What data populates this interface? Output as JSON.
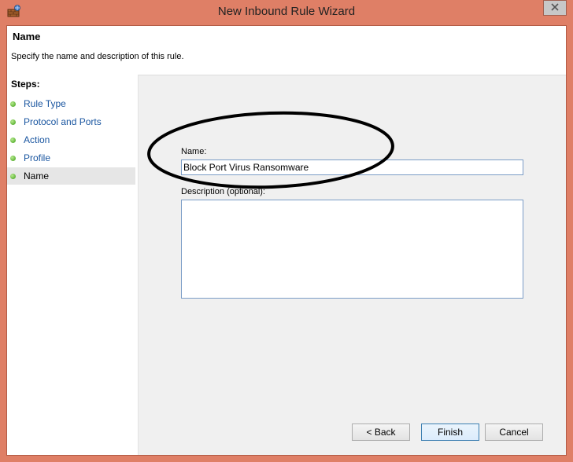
{
  "window": {
    "title": "New Inbound Rule Wizard"
  },
  "header": {
    "title": "Name",
    "description": "Specify the name and description of this rule."
  },
  "steps": {
    "heading": "Steps:",
    "items": [
      {
        "label": "Rule Type",
        "current": false
      },
      {
        "label": "Protocol and Ports",
        "current": false
      },
      {
        "label": "Action",
        "current": false
      },
      {
        "label": "Profile",
        "current": false
      },
      {
        "label": "Name",
        "current": true
      }
    ]
  },
  "form": {
    "name_label": "Name:",
    "name_value": "Block Port Virus Ransomware",
    "description_label": "Description (optional):",
    "description_value": ""
  },
  "buttons": {
    "back": "< Back",
    "finish": "Finish",
    "cancel": "Cancel"
  },
  "colors": {
    "frame": "#df7f66",
    "step_link": "#1a56a0",
    "step_dot": "#3d9f17"
  }
}
